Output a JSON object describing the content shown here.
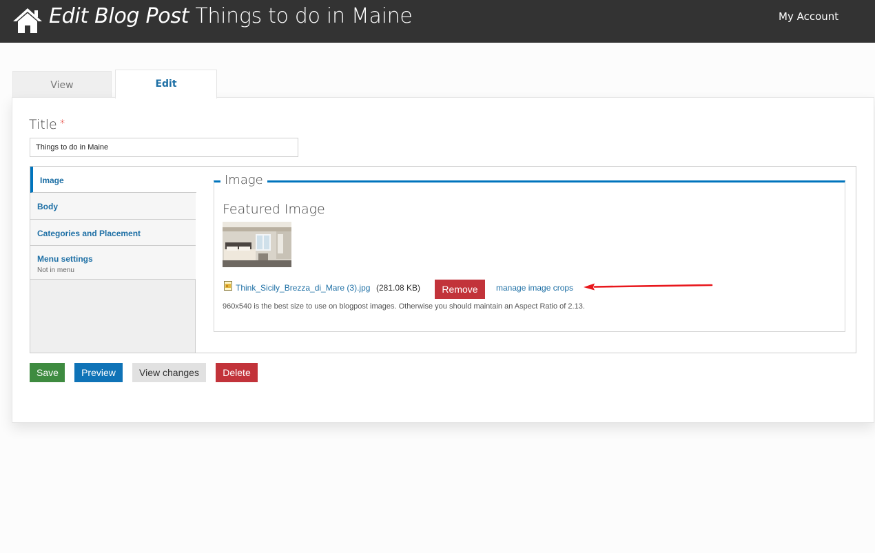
{
  "header": {
    "heading_italic": "Edit Blog Post",
    "heading_title": "Things to do in Maine",
    "account_link": "My Account"
  },
  "tabs": [
    {
      "label": "View",
      "active": false
    },
    {
      "label": "Edit",
      "active": true
    }
  ],
  "form": {
    "title_label": "Title",
    "required_mark": "*",
    "title_value": "Things to do in Maine"
  },
  "vertical_tabs": [
    {
      "label": "Image",
      "summary": "",
      "active": true
    },
    {
      "label": "Body",
      "summary": "",
      "active": false
    },
    {
      "label": "Categories and Placement",
      "summary": "",
      "active": false
    },
    {
      "label": "Menu settings",
      "summary": "Not in menu",
      "active": false
    }
  ],
  "image_section": {
    "legend": "Image",
    "featured_label": "Featured Image",
    "file_name": "Think_Sicily_Brezza_di_Mare (3).jpg",
    "file_size": "(281.08 KB)",
    "remove_label": "Remove",
    "crops_link": "manage image crops",
    "help_text": "960x540 is the best size to use on blogpost images. Otherwise you should maintain an Aspect Ratio of 2.13."
  },
  "actions": {
    "save": "Save",
    "preview": "Preview",
    "view_changes": "View changes",
    "delete": "Delete"
  },
  "colors": {
    "topbar": "#333333",
    "link": "#1d6fa5",
    "accent": "#0074bd",
    "save": "#3e8b40",
    "danger": "#c2333a",
    "arrow": "#e8171c"
  },
  "icons": [
    "home-icon",
    "file-image-icon",
    "arrow-annotation"
  ]
}
